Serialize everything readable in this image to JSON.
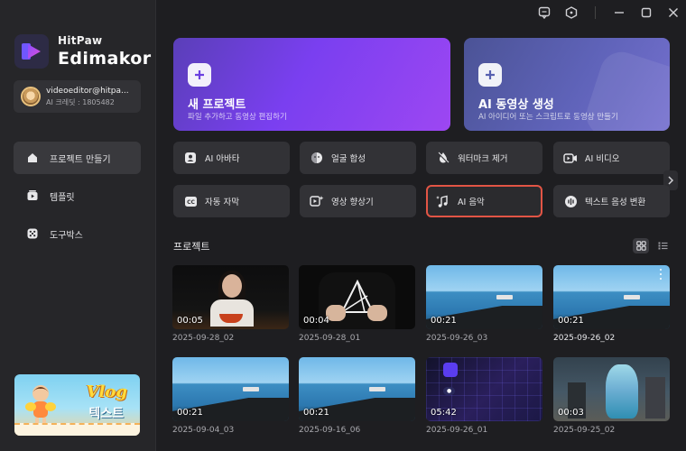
{
  "window": {
    "controls": [
      "feedback-icon",
      "help-icon",
      "minimize-icon",
      "maximize-icon",
      "close-icon"
    ]
  },
  "app": {
    "name_line1": "HitPaw",
    "name_line2": "Edimakor"
  },
  "account": {
    "email": "videoeditor@hitpa...",
    "credits": "AI 크레딧 : 1805482"
  },
  "sidebar": {
    "items": [
      {
        "label": "프로젝트 만들기",
        "icon": "home-icon",
        "active": true
      },
      {
        "label": "템플릿",
        "icon": "template-icon",
        "active": false
      },
      {
        "label": "도구박스",
        "icon": "toolbox-icon",
        "active": false
      }
    ],
    "banner": {
      "title": "Vlog",
      "subtitle": "텍스트"
    }
  },
  "hero": {
    "new_project": {
      "title": "새 프로젝트",
      "subtitle": "파일 추가하고 동영상 편집하기"
    },
    "ai_video": {
      "title": "AI 동영상 생성",
      "subtitle": "AI 아이디어 또는 스크립트로 동영상 만들기"
    }
  },
  "tools": [
    {
      "label": "AI 아바타",
      "icon": "avatar-icon",
      "highlighted": false
    },
    {
      "label": "얼굴 합성",
      "icon": "face-swap-icon",
      "highlighted": false
    },
    {
      "label": "워터마크 제거",
      "icon": "watermark-remove-icon",
      "highlighted": false
    },
    {
      "label": "AI 비디오",
      "icon": "ai-video-icon",
      "highlighted": false
    },
    {
      "label": "자동 자막",
      "icon": "subtitle-icon",
      "highlighted": false
    },
    {
      "label": "영상 향상기",
      "icon": "video-enhance-icon",
      "highlighted": false
    },
    {
      "label": "AI 음악",
      "icon": "ai-music-icon",
      "highlighted": true
    },
    {
      "label": "텍스트 음성 변환",
      "icon": "text-to-speech-icon",
      "highlighted": false
    }
  ],
  "projects": {
    "title": "프로젝트",
    "view_modes": [
      "grid-view-icon",
      "list-view-icon"
    ],
    "items": [
      {
        "name": "2025-09-28_02",
        "duration": "00:05",
        "thumb": "girl-eating"
      },
      {
        "name": "2025-09-28_01",
        "duration": "00:04",
        "thumb": "tshirt-logo"
      },
      {
        "name": "2025-09-26_03",
        "duration": "00:21",
        "thumb": "sea"
      },
      {
        "name": "2025-09-26_02",
        "duration": "00:21",
        "thumb": "sea",
        "hovered": true
      },
      {
        "name": "2025-09-04_03",
        "duration": "00:21",
        "thumb": "sea"
      },
      {
        "name": "2025-09-16_06",
        "duration": "00:21",
        "thumb": "sea"
      },
      {
        "name": "2025-09-26_01",
        "duration": "05:42",
        "thumb": "video-promo"
      },
      {
        "name": "2025-09-25_02",
        "duration": "00:03",
        "thumb": "mermaid"
      }
    ]
  },
  "colors": {
    "accent_purple": "#7a3ff0",
    "highlight_border": "#e25545",
    "bg": "#1e1e21",
    "sidebar_bg": "#262629"
  }
}
